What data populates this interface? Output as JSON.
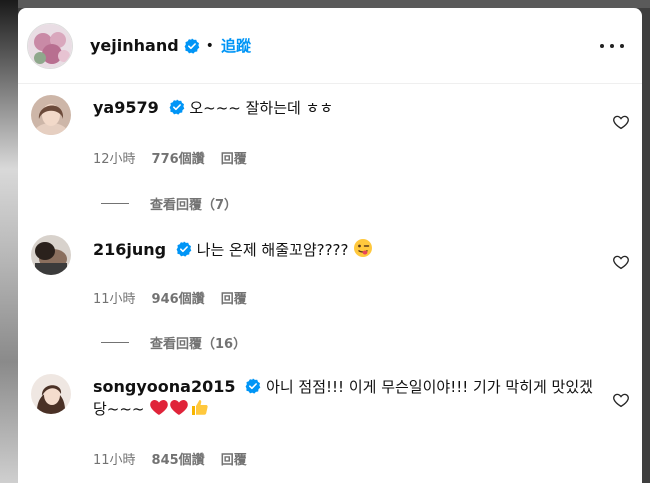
{
  "post": {
    "author": "yejinhand",
    "separator": "•",
    "follow_label": "追蹤"
  },
  "comments": [
    {
      "username": "ya9579",
      "text": "오~~~ 잘하는데 ㅎㅎ",
      "time": "12小時",
      "likes": "776個讚",
      "reply_label": "回覆",
      "view_replies": "查看回覆（7）"
    },
    {
      "username": "216jung",
      "text": "나는 온제 해줄꼬얌????",
      "emoji": "winking-tongue-face-emoji",
      "time": "11小時",
      "likes": "946個讚",
      "reply_label": "回覆",
      "view_replies": "查看回覆（16）"
    },
    {
      "username": "songyoona2015",
      "text": "아니 점점!!! 이게 무슨일이야!!! 기가 막히게 맛있겠당~~~",
      "emoji": "red-heart-red-heart-thumbs-up-emoji",
      "time": "11小時",
      "likes": "845個讚",
      "reply_label": "回覆"
    }
  ],
  "colors": {
    "accent": "#0095f6",
    "verified": "#0095f6",
    "secondary_text": "#737373"
  }
}
